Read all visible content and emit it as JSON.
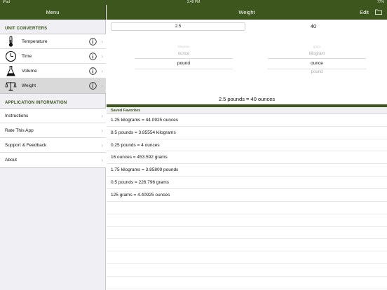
{
  "status_bar": {
    "carrier": "iPad",
    "time": "3:48 PM",
    "battery": "77%"
  },
  "sidebar": {
    "title": "Menu",
    "converters_header": "UNIT CONVERTERS",
    "converters": [
      {
        "label": "Temperature",
        "icon": "thermometer-icon"
      },
      {
        "label": "Time",
        "icon": "clock-icon"
      },
      {
        "label": "Volume",
        "icon": "flask-icon"
      },
      {
        "label": "Weight",
        "icon": "scale-icon",
        "selected": true
      }
    ],
    "info_header": "APPLICATION INFORMATION",
    "info_items": [
      {
        "label": "Instructions"
      },
      {
        "label": "Rate This App"
      },
      {
        "label": "Support & Feedback"
      },
      {
        "label": "About"
      }
    ]
  },
  "header": {
    "title": "Weight",
    "edit_label": "Edit",
    "folder_icon": "folder-icon"
  },
  "converter": {
    "input_value": "2.5",
    "result_value": "40",
    "from_picker": {
      "above_far": "kilogram",
      "above": "ounce",
      "selected": "pound"
    },
    "to_picker": {
      "above_far": "gram",
      "above": "kilogram",
      "selected": "ounce",
      "below": "pound"
    },
    "summary": "2.5 pounds = 40 ounces"
  },
  "favorites": {
    "header": "Saved Favorites",
    "items": [
      "1.25 kilograms = 44.0925 ounces",
      "8.5 pounds = 3.85554 kilograms",
      "0.25 pounds = 4 ounces",
      "16 ounces = 453.592 grams",
      "1.75 kilograms = 3.85809 pounds",
      "0.5 pounds = 226.796 grams",
      "125 grams = 4.40925 ounces"
    ]
  },
  "colors": {
    "accent": "#3d561e",
    "sidebar_bg": "#efeff4",
    "selected_row": "#d9d9d9"
  }
}
